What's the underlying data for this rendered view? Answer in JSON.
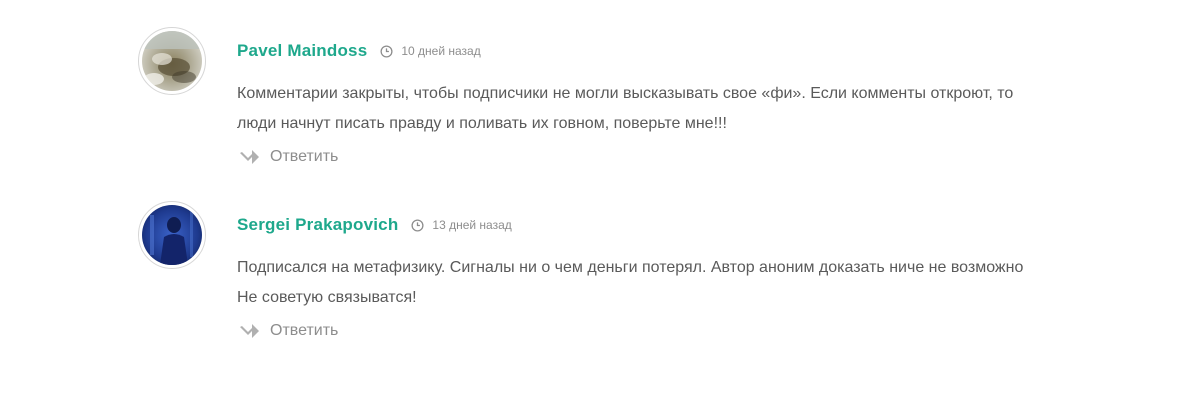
{
  "comments": [
    {
      "author": "Pavel Maindoss",
      "time": "10 дней назад",
      "text": "Комментарии закрыты, чтобы подписчики не могли высказывать свое «фи». Если комменты откроют, то люди начнут писать правду и поливать их говном, поверьте мне!!!",
      "reply_label": "Ответить",
      "avatar_icon": "avatar-photo"
    },
    {
      "author": "Sergei Prakapovich",
      "time": "13 дней назад",
      "text": "Подписался на метафизику. Сигналы ни о чем деньги потерял. Автор аноним доказать ниче не возможно Не советую связыватся!",
      "reply_label": "Ответить",
      "avatar_icon": "avatar-photo"
    }
  ],
  "colors": {
    "author": "#1ea88c",
    "text": "#5a5a5a",
    "muted": "#8d8d8d",
    "reply_icon": "#b0b0b0"
  }
}
